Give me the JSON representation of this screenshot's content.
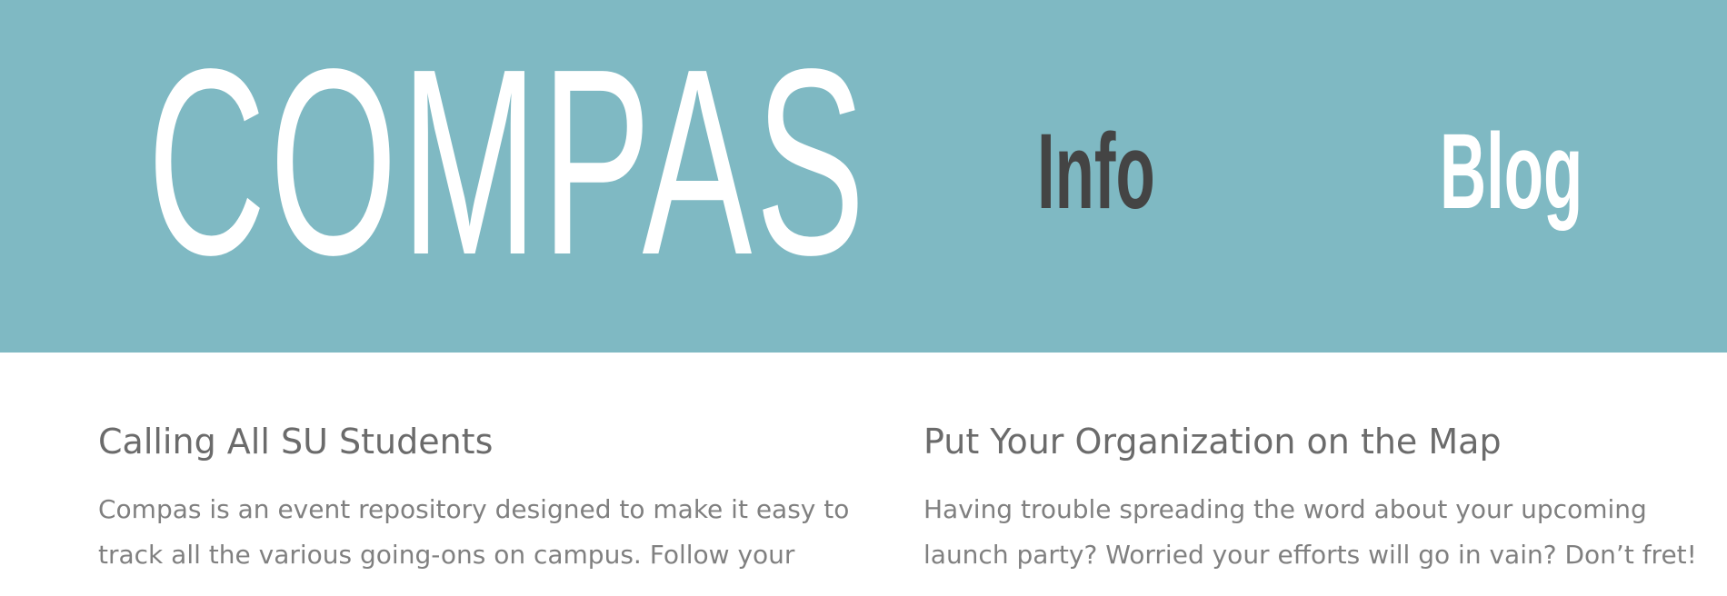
{
  "header": {
    "logo": "COMPAS",
    "nav": {
      "info": "Info",
      "blog": "Blog"
    },
    "colors": {
      "background": "#7fb9c3",
      "active_link": "#444444",
      "link": "#ffffff"
    }
  },
  "sections": [
    {
      "heading": "Calling All SU Students",
      "lines": [
        "Compas is an event repository designed to make it easy to",
        "track all the various going-ons on campus. Follow your"
      ]
    },
    {
      "heading": "Put Your Organization on the Map",
      "lines": [
        "Having trouble spreading the word about your upcoming",
        "launch party? Worried your efforts will go in vain? Don’t fret!"
      ]
    }
  ]
}
